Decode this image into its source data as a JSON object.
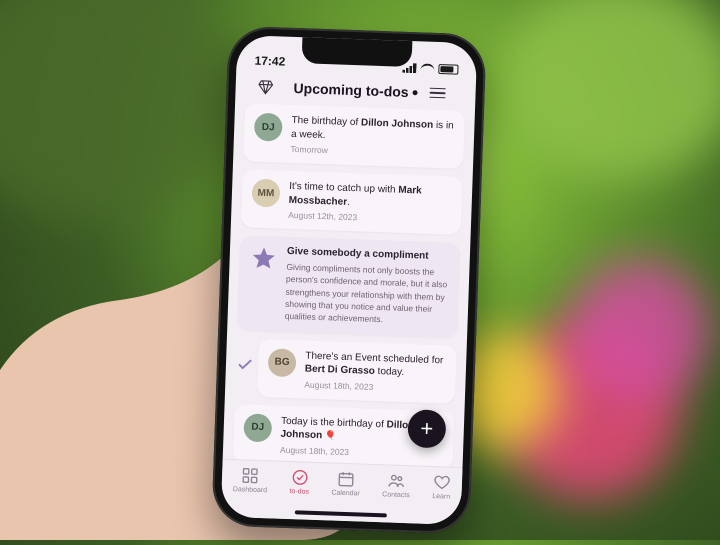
{
  "status": {
    "time": "17:42"
  },
  "header": {
    "title": "Upcoming to-dos"
  },
  "cards": [
    {
      "avatar": "DJ",
      "text_pre": "The birthday of ",
      "text_bold": "Dillon Johnson",
      "text_post": " is in a week.",
      "date": "Tomorrow"
    },
    {
      "avatar": "MM",
      "text_pre": "It's time to catch up with ",
      "text_bold": "Mark Mossbacher",
      "text_post": ".",
      "date": "August 12th, 2023"
    },
    {
      "tip_title": "Give somebody a compliment",
      "tip_text": "Giving compliments not only boosts the person's confidence and morale, but it also strengthens your relationship with them by showing that you notice and value their qualities or achievements."
    },
    {
      "avatar": "BG",
      "text_pre": "There's an Event scheduled for ",
      "text_bold": "Bert Di Grasso",
      "text_post": " today.",
      "date": "August 18th, 2023",
      "checked": true
    },
    {
      "avatar": "DJ",
      "text_pre": "Today is the birthday of ",
      "text_bold": "Dillon Johnson",
      "text_post": " 🎈",
      "date": "August 18th, 2023"
    }
  ],
  "tabs": {
    "dashboard": "Dashboard",
    "todos": "to-dos",
    "calendar": "Calendar",
    "contacts": "Contacts",
    "learn": "Learn"
  },
  "fab": "+"
}
